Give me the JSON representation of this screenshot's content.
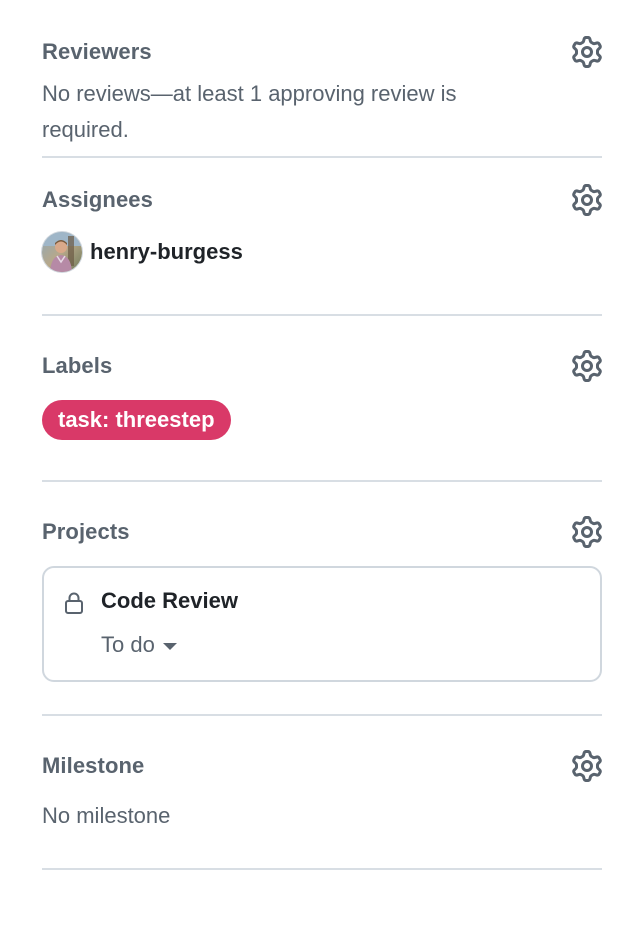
{
  "reviewers": {
    "title": "Reviewers",
    "status": "No reviews—at least 1 approving review is required."
  },
  "assignees": {
    "title": "Assignees",
    "users": [
      {
        "login": "henry-burgess"
      }
    ]
  },
  "labels": {
    "title": "Labels",
    "items": [
      {
        "name": "task: threestep",
        "color": "#d93968"
      }
    ]
  },
  "projects": {
    "title": "Projects",
    "items": [
      {
        "name": "Code Review",
        "status": "To do",
        "icon": "lock-icon"
      }
    ]
  },
  "milestone": {
    "title": "Milestone",
    "status": "No milestone"
  },
  "icons": {
    "settings": "gear-icon",
    "project_visibility": "lock-icon",
    "dropdown": "triangle-down-icon"
  },
  "colors": {
    "muted_text": "#59636e",
    "primary_text": "#1f2328",
    "divider": "#d8dee4",
    "label": "#d93968"
  }
}
